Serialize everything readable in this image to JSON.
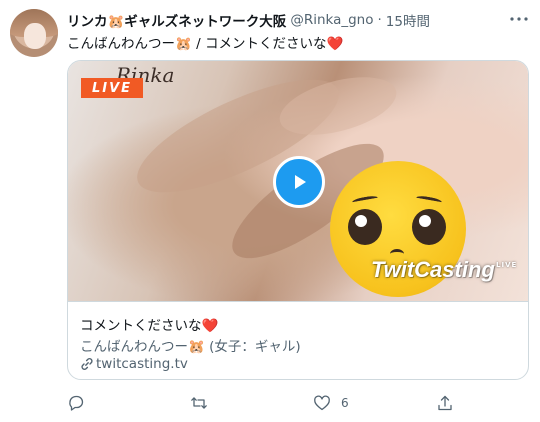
{
  "tweet": {
    "display_name": "リンカ🐹ギャルズネットワーク大阪",
    "handle": "@Rinka_gno",
    "separator": "·",
    "timestamp": "15時間",
    "text": "こんばんわんつー🐹 / コメントくださいな❤️"
  },
  "card": {
    "watermark": "Rinka",
    "live_badge": "LIVE",
    "brand_logo": "TwitCasting",
    "brand_live": "LIVE",
    "title": "コメントくださいな❤️",
    "description": "こんばんわんつー🐹 (女子：ギャル)",
    "domain": "twitcasting.tv"
  },
  "actions": {
    "reply_count": "",
    "retweet_count": "",
    "like_count": "6",
    "share_count": ""
  },
  "colors": {
    "accent": "#1d9bf0",
    "live_badge": "#f15a24",
    "secondary_text": "#536471",
    "border": "#cfd9de"
  },
  "icons": [
    "more-icon",
    "play-icon",
    "link-icon",
    "reply-icon",
    "retweet-icon",
    "like-icon",
    "share-icon"
  ]
}
